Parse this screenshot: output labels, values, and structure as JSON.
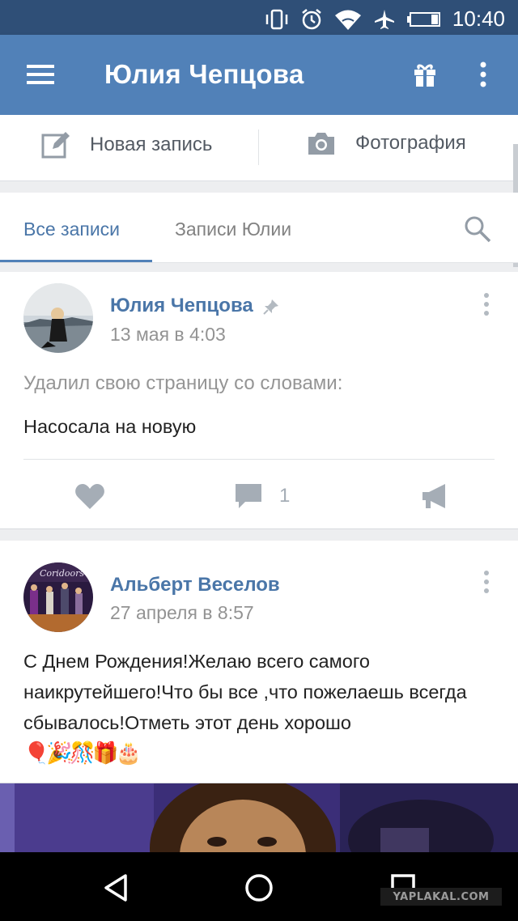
{
  "status_bar": {
    "time": "10:40",
    "icons": [
      "vibrate-icon",
      "alarm-icon",
      "wifi-icon",
      "airplane-icon",
      "battery-icon"
    ]
  },
  "app_bar": {
    "title": "Юлия Чепцова",
    "icons": [
      "menu-icon",
      "gift-icon",
      "more-vert-icon"
    ]
  },
  "composer": {
    "new_post_label": "Новая запись",
    "photo_label": "Фотография"
  },
  "tabs": [
    {
      "label": "Все записи",
      "selected": true
    },
    {
      "label": "Записи Юлии",
      "selected": false
    }
  ],
  "posts": [
    {
      "author": "Юлия Чепцова",
      "pinned": true,
      "date": "13 мая в 4:03",
      "muted_text": "Удалил свою страницу со словами:",
      "text": "Насосала на новую",
      "comments_count": "1"
    },
    {
      "author": "Альберт Веселов",
      "date": "27 апреля в 8:57",
      "text": "С Днем Рождения!Желаю всего самого наикрутейшего!Что бы все ,что пожелаешь всегда сбывалось!Отметь этот день хорошо",
      "emoji": "🎈🎉🎊🎁🎂",
      "avatar_caption": "Coridoors"
    }
  ],
  "watermark": "YAPLAKAL.COM",
  "colors": {
    "appbar": "#5181b8",
    "statusbar": "#2f4f77",
    "link": "#4a76a8"
  }
}
